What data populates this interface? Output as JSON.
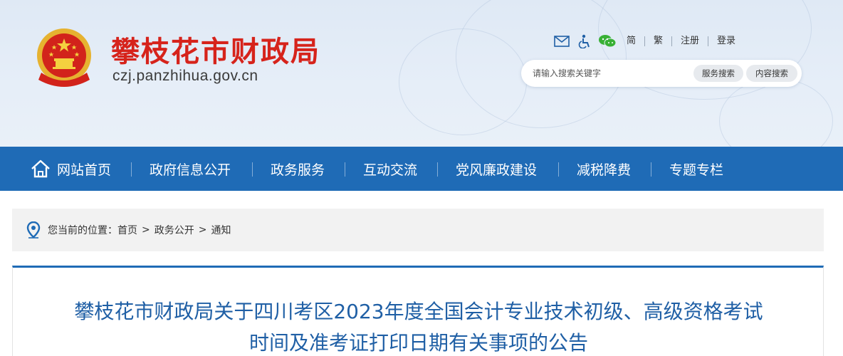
{
  "header": {
    "site_title": "攀枝花市财政局",
    "site_url": "czj.panzhihua.gov.cn",
    "toolbar": {
      "icons": [
        "mail-icon",
        "accessibility-icon",
        "wechat-icon"
      ],
      "links": [
        "简",
        "繁",
        "注册",
        "登录"
      ]
    },
    "search": {
      "placeholder": "请输入搜索关键字",
      "service_search_label": "服务搜索",
      "content_search_label": "内容搜索"
    }
  },
  "nav": {
    "home_label": "网站首页",
    "items": [
      "政府信息公开",
      "政务服务",
      "互动交流",
      "党风廉政建设",
      "减税降费",
      "专题专栏"
    ]
  },
  "breadcrumb": {
    "prefix": "您当前的位置：",
    "items": [
      "首页",
      "政务公开",
      "通知"
    ],
    "separator": ">"
  },
  "article": {
    "title_line1": "攀枝花市财政局关于四川考区2023年度全国会计专业技术初级、高级资格考试",
    "title_line2": "时间及准考证打印日期有关事项的公告"
  },
  "colors": {
    "brand_red": "#d6231b",
    "nav_blue": "#1f6bb6",
    "title_blue": "#1f5fa5",
    "header_bg": "#e4ecf6"
  }
}
